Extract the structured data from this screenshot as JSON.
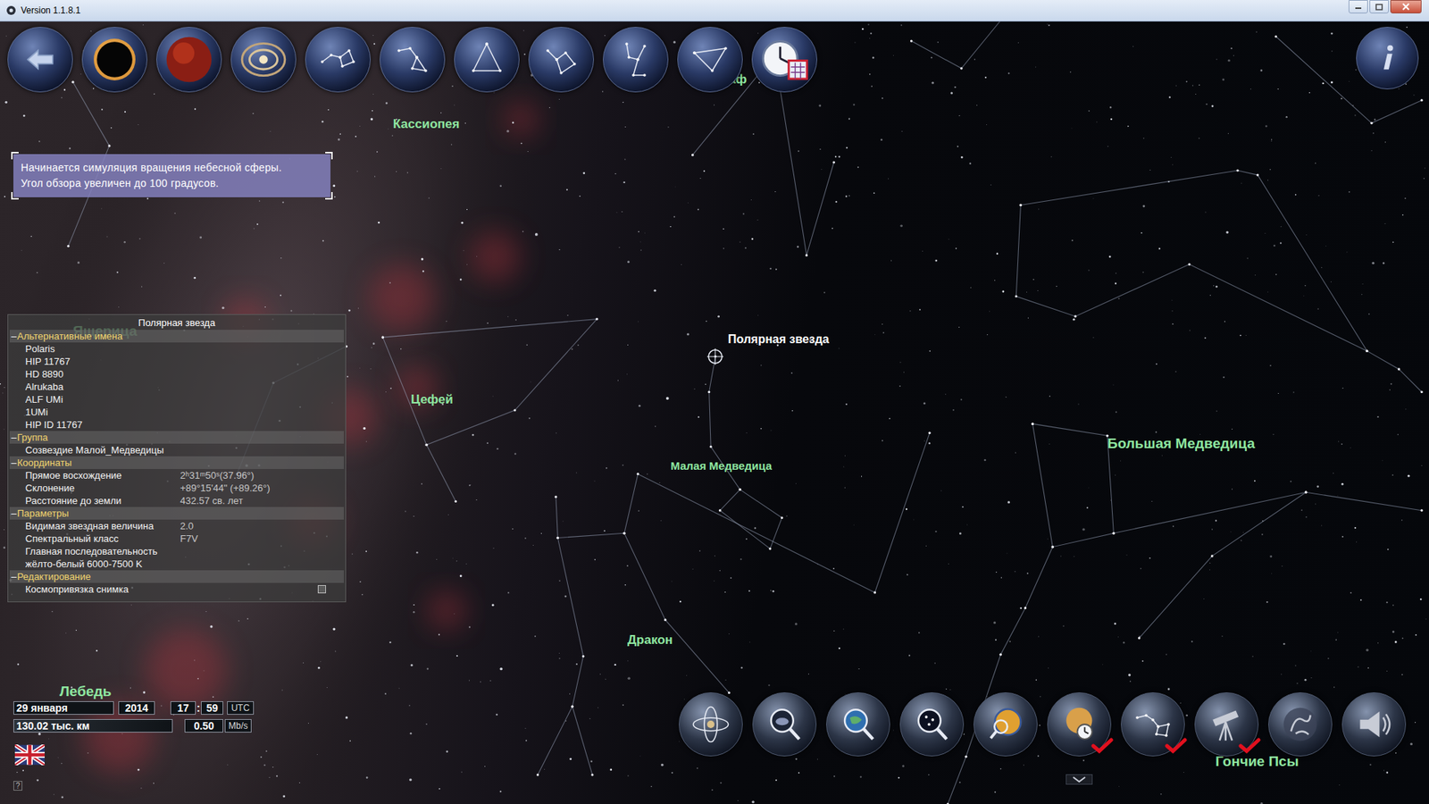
{
  "window": {
    "title": "Version 1.1.8.1"
  },
  "sky": {
    "labels": [
      "аф",
      "Кассиопея",
      "Ящерица",
      "Цефей",
      "Малая Медведица",
      "Большая Медведица",
      "Дракон",
      "Лебедь",
      "Гончие Псы"
    ],
    "selected_star": "Полярная звезда"
  },
  "notification": {
    "lines": [
      "Начинается симуляция вращения небесной сферы.",
      "Угол обзора увеличен до 100 градусов."
    ]
  },
  "info_panel": {
    "title": "Полярная звезда",
    "sections": [
      {
        "title": "Альтернативные имена",
        "toggle": "–",
        "expanded": true,
        "rows": [
          {
            "kind": "text",
            "label": "Polaris"
          },
          {
            "kind": "text",
            "label": "HIP 11767"
          },
          {
            "kind": "text",
            "label": "HD 8890"
          },
          {
            "kind": "text",
            "label": "Alrukaba"
          },
          {
            "kind": "text",
            "label": "ALF UMi"
          },
          {
            "kind": "text",
            "label": "1UMi"
          },
          {
            "kind": "text",
            "label": "HIP ID 11767"
          }
        ]
      },
      {
        "title": "Группа",
        "toggle": "–",
        "expanded": true,
        "rows": [
          {
            "kind": "text",
            "label": "Созвездие Малой_Медведицы"
          }
        ]
      },
      {
        "title": "Координаты",
        "toggle": "–",
        "expanded": true,
        "rows": [
          {
            "kind": "pair",
            "label": "Прямое восхождение",
            "value": "2ʰ31ᵐ50ˢ(37.96°)"
          },
          {
            "kind": "pair",
            "label": "Склонение",
            "value": "+89°15'44\" (+89.26°)"
          },
          {
            "kind": "pair",
            "label": "Расстояние до земли",
            "value": "432.57 св. лет"
          }
        ]
      },
      {
        "title": "Параметры",
        "toggle": "–",
        "expanded": true,
        "rows": [
          {
            "kind": "pair",
            "label": "Видимая звездная величина",
            "value": "2.0"
          },
          {
            "kind": "pair",
            "label": "Спектральный класс",
            "value": "F7V"
          },
          {
            "kind": "text",
            "label": "Главная последовательность"
          },
          {
            "kind": "text",
            "label": "жёлто-белый 6000-7500 K"
          }
        ]
      },
      {
        "title": "Редактирование",
        "toggle": "–",
        "expanded": true,
        "rows": [
          {
            "kind": "checkbox",
            "label": "Космопривязка снимка",
            "checked": false
          }
        ]
      }
    ]
  },
  "time_bar": {
    "date": "29 января",
    "year": "2014",
    "hour": "17",
    "separator": ":",
    "minute": "59",
    "zone": "UTC",
    "distance": "130.02 тыс. км",
    "speed": "0.50",
    "speed_unit": "Mb/s"
  },
  "bottom_toolbar": [
    {
      "checked": false
    },
    {
      "checked": false
    },
    {
      "checked": false
    },
    {
      "checked": false
    },
    {
      "checked": false
    },
    {
      "checked": true
    },
    {
      "checked": true
    },
    {
      "checked": true
    },
    {
      "checked": false
    },
    {
      "checked": false
    }
  ],
  "help": "?"
}
